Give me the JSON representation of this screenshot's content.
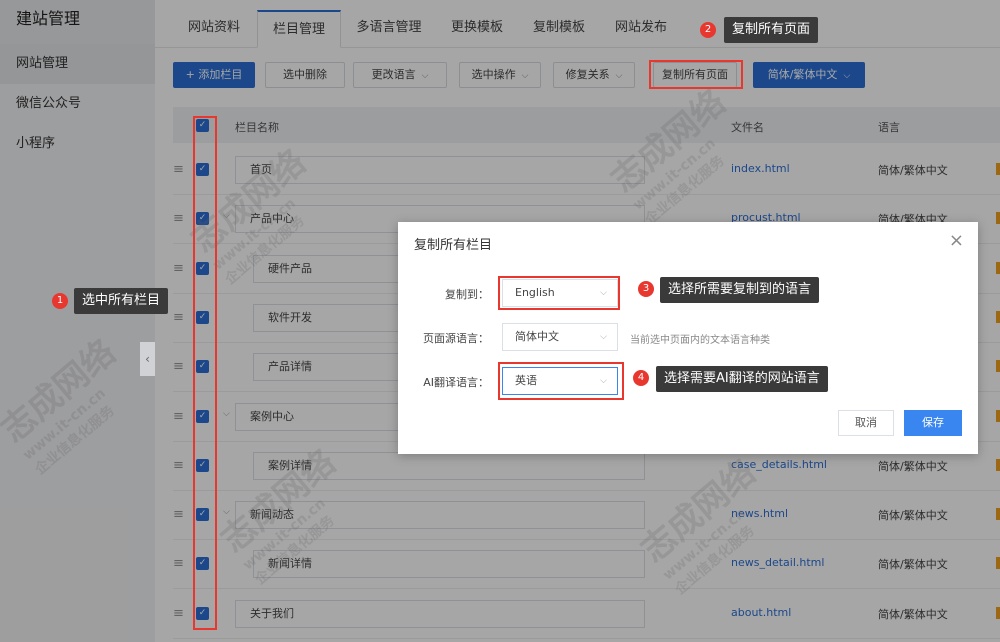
{
  "sidebar": {
    "title": "建站管理",
    "items": [
      {
        "label": "网站管理",
        "active": true
      },
      {
        "label": "微信公众号",
        "active": false
      },
      {
        "label": "小程序",
        "active": false
      }
    ],
    "collapse_glyph": "‹"
  },
  "tabs": [
    {
      "label": "网站资料",
      "active": false
    },
    {
      "label": "栏目管理",
      "active": true
    },
    {
      "label": "多语言管理",
      "active": false
    },
    {
      "label": "更换模板",
      "active": false
    },
    {
      "label": "复制模板",
      "active": false
    },
    {
      "label": "网站发布",
      "active": false
    }
  ],
  "toolbar": {
    "add_label": "+ 添加栏目",
    "delete_label": "选中删除",
    "change_lang_label": "更改语言",
    "select_op_label": "选中操作",
    "fix_relation_label": "修复关系",
    "copy_all_label": "复制所有页面",
    "lang_switch_label": "简体/繁体中文"
  },
  "table": {
    "headers": {
      "name": "栏目名称",
      "file": "文件名",
      "lang": "语言"
    },
    "rows": [
      {
        "name": "首页",
        "file": "index.html",
        "lang": "简体/繁体中文",
        "level": 0,
        "expand": false
      },
      {
        "name": "产品中心",
        "file": "procust.html",
        "lang": "简体/繁体中文",
        "level": 0,
        "expand": true
      },
      {
        "name": "硬件产品",
        "file": "",
        "lang": "",
        "level": 1,
        "expand": false
      },
      {
        "name": "软件开发",
        "file": "",
        "lang": "",
        "level": 1,
        "expand": false
      },
      {
        "name": "产品详情",
        "file": "",
        "lang": "",
        "level": 1,
        "expand": false
      },
      {
        "name": "案例中心",
        "file": "",
        "lang": "",
        "level": 0,
        "expand": true
      },
      {
        "name": "案例详情",
        "file": "case_details.html",
        "lang": "简体/繁体中文",
        "level": 1,
        "expand": false
      },
      {
        "name": "新闻动态",
        "file": "news.html",
        "lang": "简体/繁体中文",
        "level": 0,
        "expand": true
      },
      {
        "name": "新闻详情",
        "file": "news_detail.html",
        "lang": "简体/繁体中文",
        "level": 1,
        "expand": false
      },
      {
        "name": "关于我们",
        "file": "about.html",
        "lang": "简体/繁体中文",
        "level": 0,
        "expand": false
      }
    ]
  },
  "dialog": {
    "title": "复制所有栏目",
    "copy_to_label": "复制到：",
    "copy_to_value": "English",
    "source_lang_label": "页面源语言：",
    "source_lang_value": "简体中文",
    "source_lang_hint": "当前选中页面内的文本语言种类",
    "ai_lang_label": "AI翻译语言：",
    "ai_lang_value": "英语",
    "cancel_label": "取消",
    "save_label": "保存",
    "close_glyph": "×"
  },
  "annotations": [
    {
      "num": "1",
      "text": "选中所有栏目"
    },
    {
      "num": "2",
      "text": "复制所有页面"
    },
    {
      "num": "3",
      "text": "选择所需要复制到的语言"
    },
    {
      "num": "4",
      "text": "选择需要AI翻译的网站语言"
    }
  ],
  "watermark": {
    "name": "志成网络",
    "url": "www.it-cn.cn",
    "slogan": "企业信息化服务"
  },
  "colors": {
    "accent": "#2c6fd6",
    "annotation_red": "#e8372f",
    "tooltip_bg": "#3a3a3a",
    "save_button": "#3a86f0"
  }
}
